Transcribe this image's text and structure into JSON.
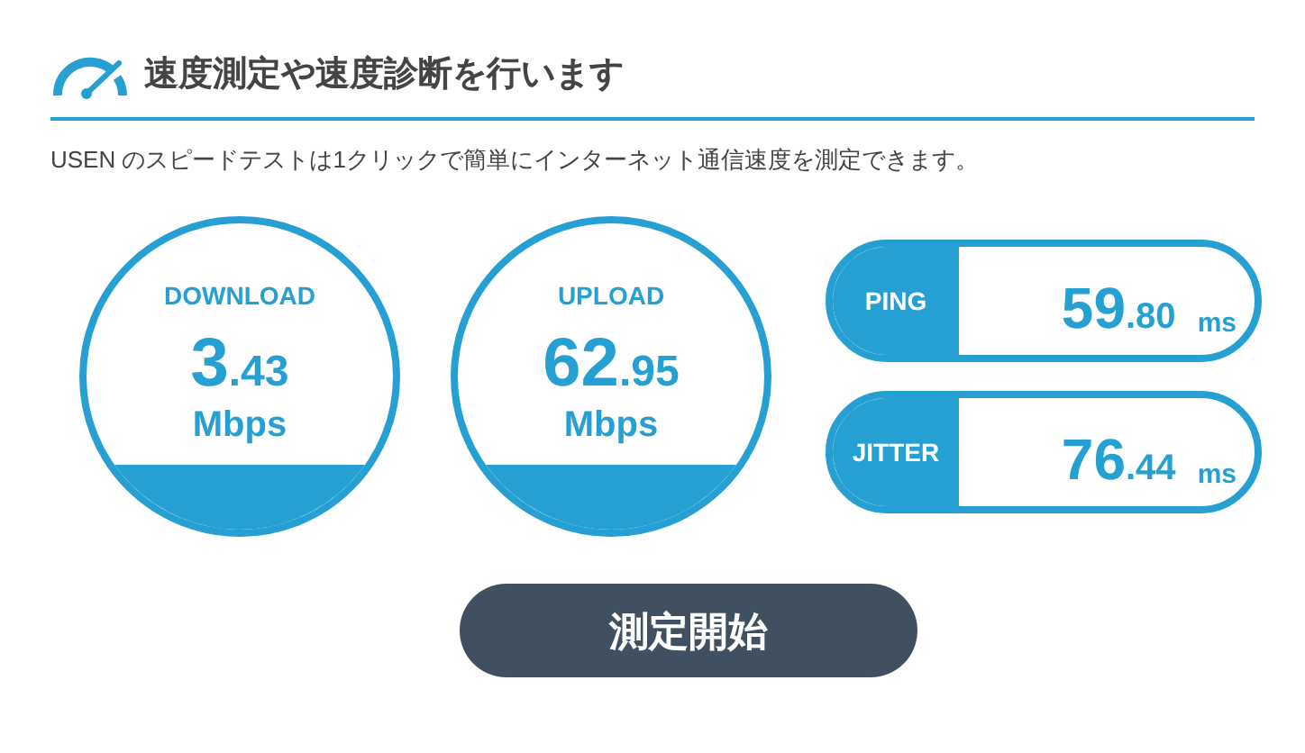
{
  "heading": "速度測定や速度診断を行います",
  "description": "USEN のスピードテストは1クリックで簡単にインターネット通信速度を測定できます。",
  "gauges": [
    {
      "label": "DOWNLOAD",
      "integer": "3",
      "decimal": ".43",
      "unit": "Mbps"
    },
    {
      "label": "UPLOAD",
      "integer": "62",
      "decimal": ".95",
      "unit": "Mbps"
    }
  ],
  "metrics": [
    {
      "label": "PING",
      "integer": "59",
      "decimal": ".80",
      "unit": "ms"
    },
    {
      "label": "JITTER",
      "integer": "76",
      "decimal": ".44",
      "unit": "ms"
    }
  ],
  "start_button": "測定開始"
}
